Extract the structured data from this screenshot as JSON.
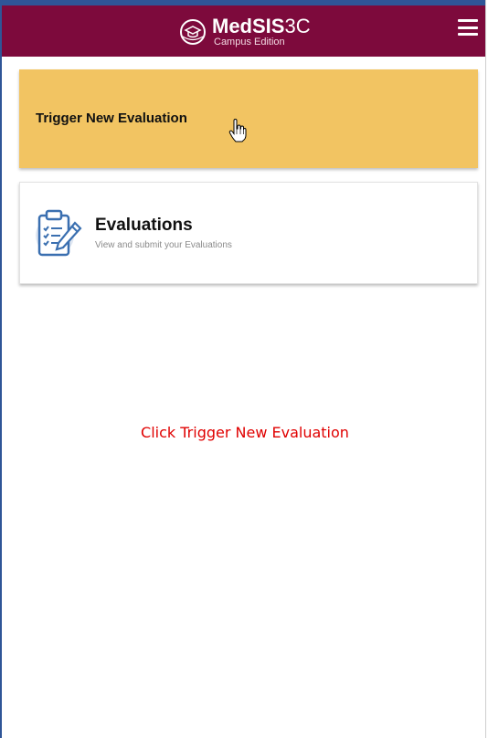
{
  "header": {
    "logo_bold": "MedSIS",
    "logo_suffix": "3C",
    "logo_sub": "Campus Edition",
    "menu_icon": "hamburger-menu-icon"
  },
  "trigger_card": {
    "label": "Trigger New Evaluation"
  },
  "evaluations_card": {
    "title": "Evaluations",
    "subtitle": "View and submit your Evaluations",
    "icon": "clipboard-checklist-icon"
  },
  "instruction": {
    "text": "Click Trigger New Evaluation"
  },
  "colors": {
    "topbar": "#7d0a3c",
    "topbar_border": "#2f5597",
    "trigger_card": "#f2c462",
    "instruction_text": "#e00000",
    "icon_blue": "#3a6fb0"
  }
}
